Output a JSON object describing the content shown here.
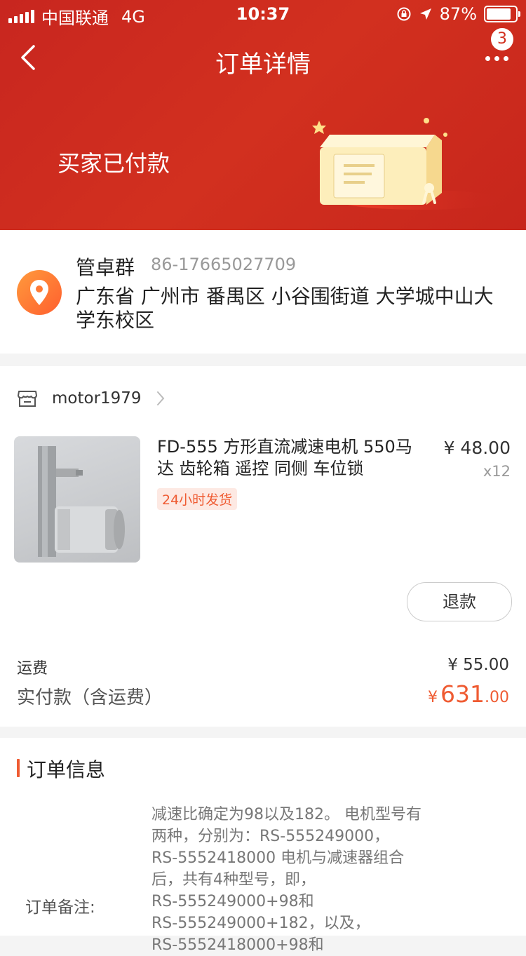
{
  "status_bar": {
    "carrier": "中国联通",
    "network": "4G",
    "time": "10:37",
    "battery_percent": "87%",
    "battery_level": 0.87
  },
  "nav": {
    "title": "订单详情",
    "badge_count": "3",
    "back_icon": "chevron-left-icon",
    "more_icon": "more-dots-icon"
  },
  "header": {
    "status_text": "买家已付款"
  },
  "address": {
    "name": "管卓群",
    "phone": "86-17665027709",
    "full_address": "广东省 广州市 番禺区 小谷围街道 大学城中山大学东校区",
    "icon": "location-pin-icon"
  },
  "order": {
    "shop_name": "motor1979",
    "shop_icon": "store-icon",
    "product": {
      "title": "FD-555  方形直流减速电机 550马达 齿轮箱 遥控 同侧  车位锁",
      "price": "¥ 48.00",
      "quantity": "x12",
      "tag": "24小时发货"
    },
    "refund_label": "退款",
    "freight_label": "运费",
    "freight_value": "¥ 55.00",
    "paid_label": "实付款（含运费）",
    "paid_currency": "¥",
    "paid_integer": "631",
    "paid_decimal": ".00"
  },
  "order_info": {
    "title": "订单信息",
    "note_label": "订单备注:",
    "note_value": "减速比确定为98以及182。 电机型号有两种，分别为：RS-555249000，\nRS-5552418000 电机与减速器组合后，共有4种型号，即，\nRS-555249000+98和\nRS-555249000+182，以及，\nRS-5552418000+98和"
  },
  "colors": {
    "header_red": "#d2301f",
    "accent_orange": "#ef5b32"
  }
}
